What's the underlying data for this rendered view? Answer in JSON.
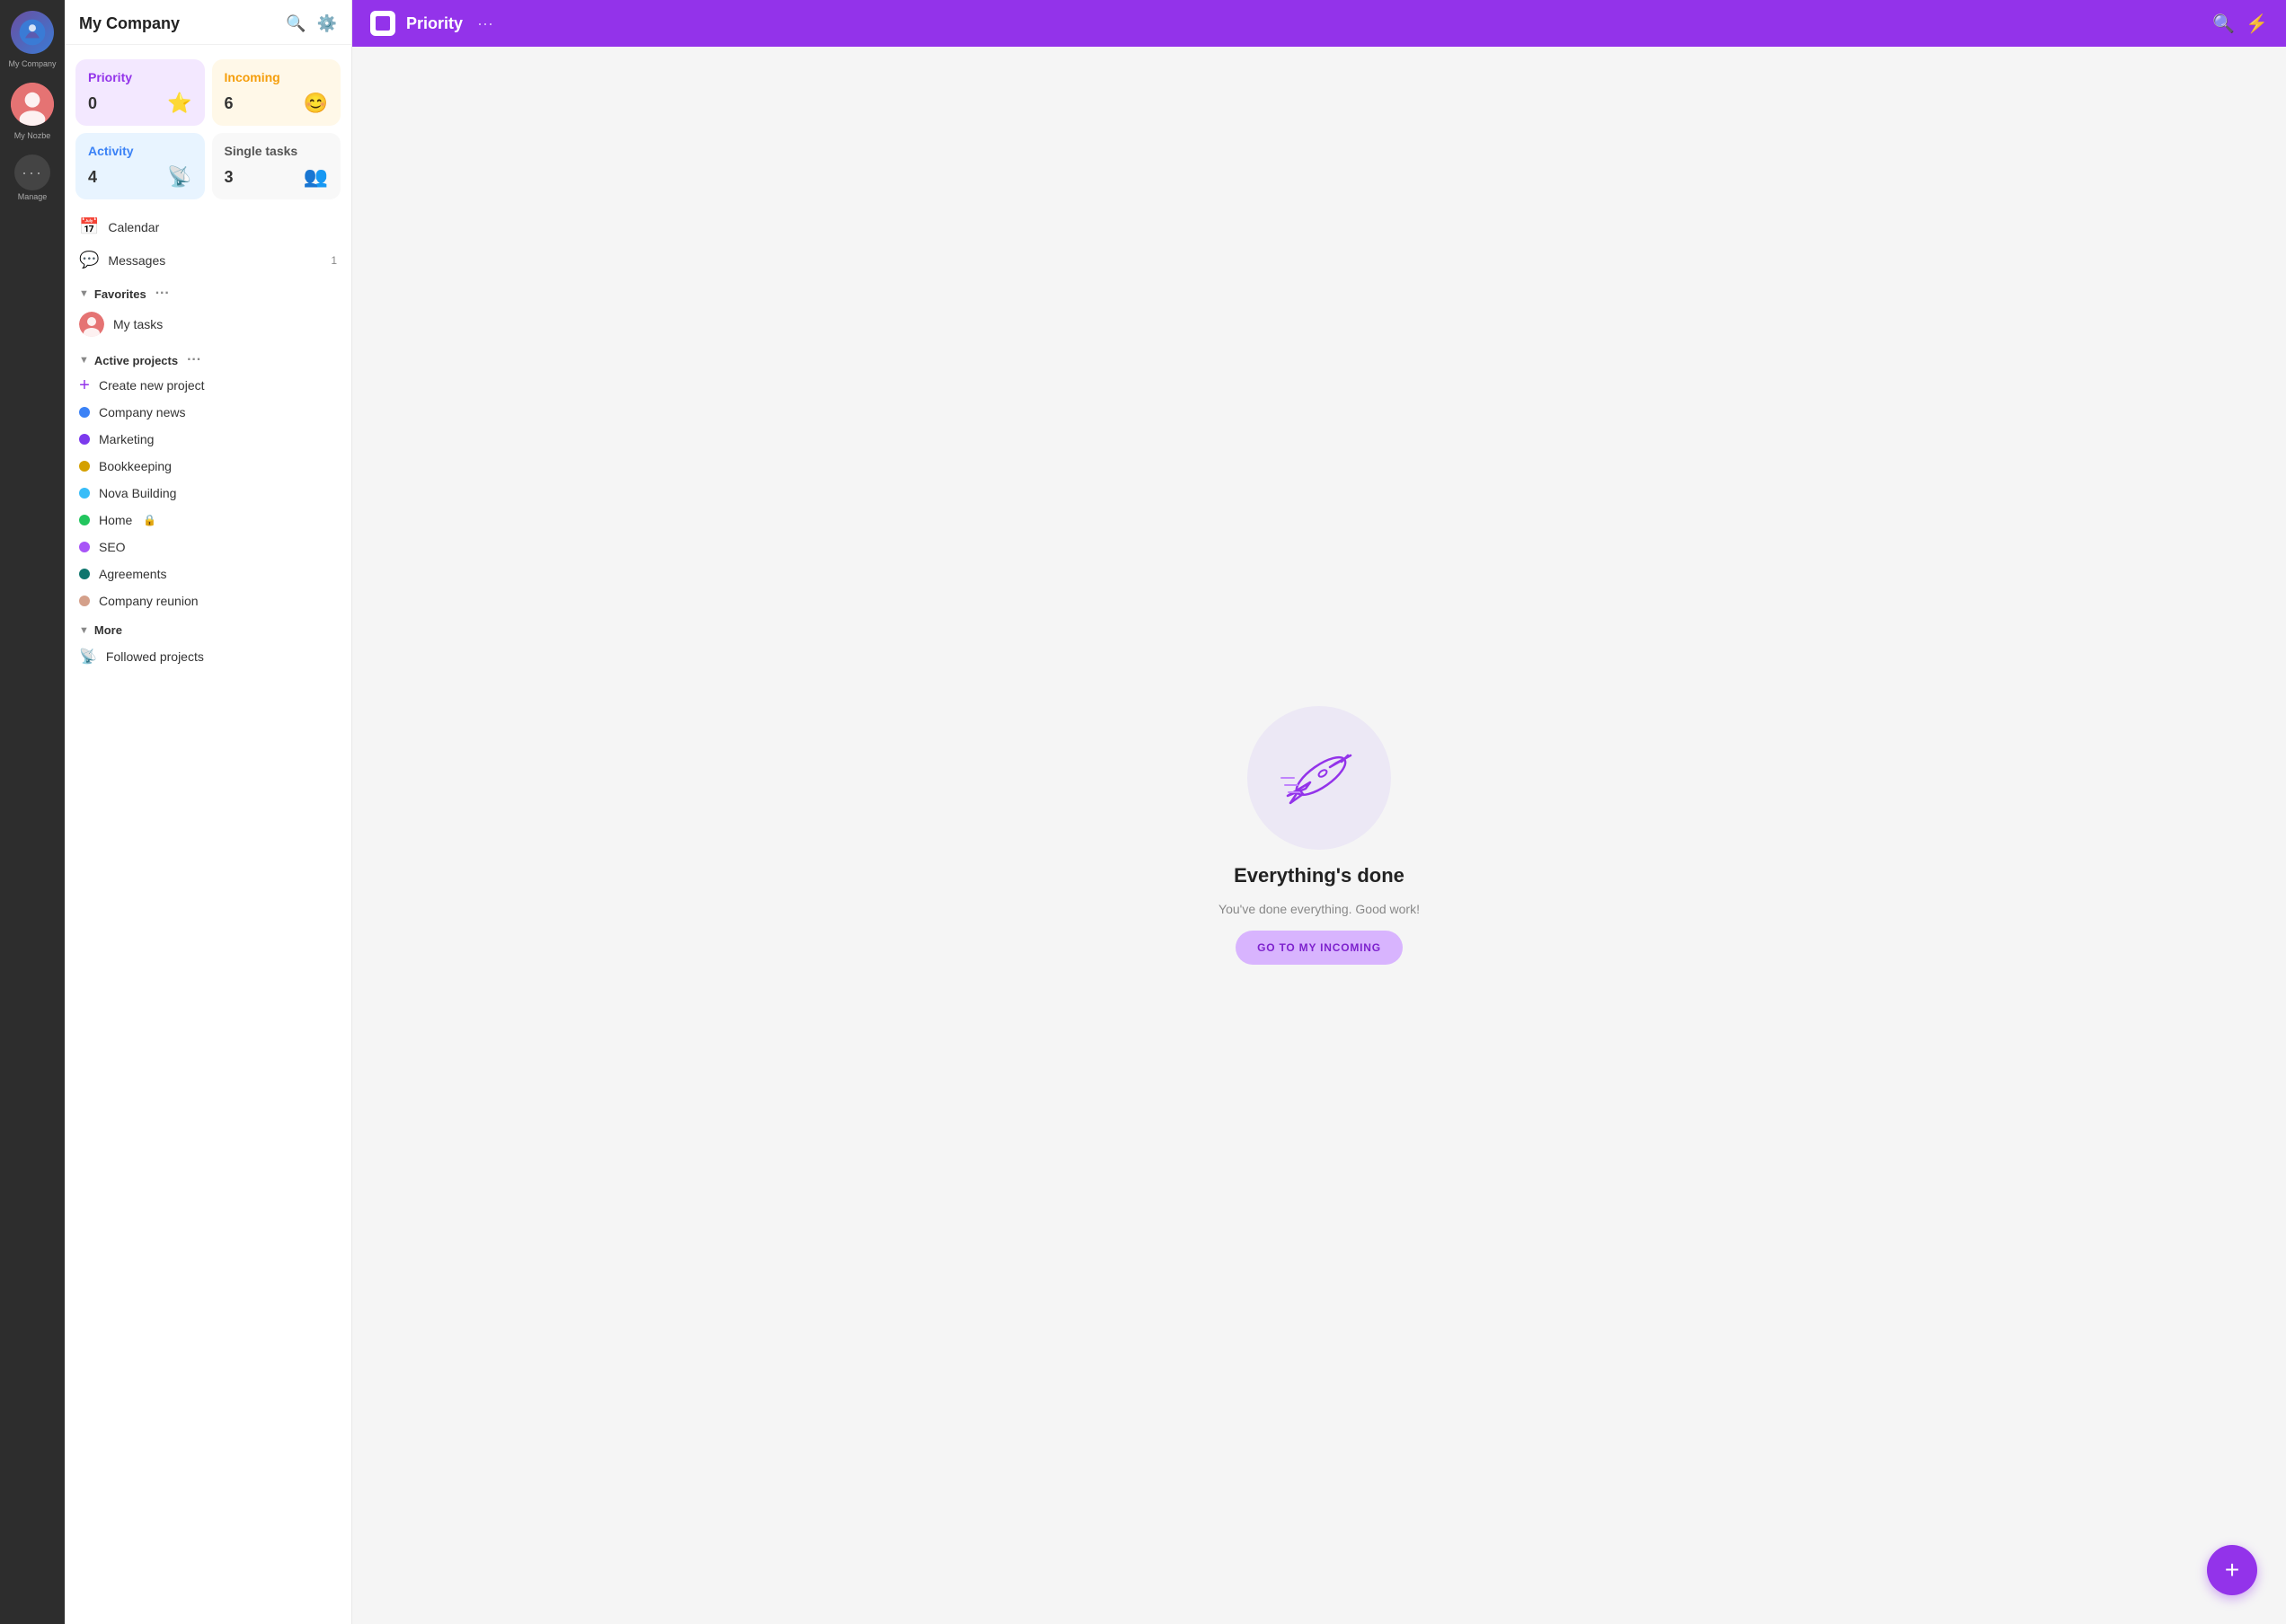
{
  "leftRail": {
    "companyLabel": "My Company",
    "nozbeLabel": "My Nozbe",
    "manageLabel": "Manage"
  },
  "sidebar": {
    "title": "My Company",
    "cards": [
      {
        "id": "priority",
        "label": "Priority",
        "count": "0",
        "icon": "⭐",
        "theme": "priority"
      },
      {
        "id": "incoming",
        "label": "Incoming",
        "count": "6",
        "icon": "😊",
        "theme": "incoming"
      },
      {
        "id": "activity",
        "label": "Activity",
        "count": "4",
        "icon": "📡",
        "theme": "activity"
      },
      {
        "id": "single",
        "label": "Single tasks",
        "count": "3",
        "icon": "👥",
        "theme": "single"
      }
    ],
    "nav": [
      {
        "id": "calendar",
        "label": "Calendar",
        "icon": "📅",
        "badge": ""
      },
      {
        "id": "messages",
        "label": "Messages",
        "icon": "💬",
        "badge": "1"
      }
    ],
    "favorites": {
      "label": "Favorites",
      "items": [
        {
          "id": "my-tasks",
          "label": "My tasks",
          "dotColor": "#e57373"
        }
      ]
    },
    "activeProjects": {
      "label": "Active projects",
      "items": [
        {
          "id": "create-new",
          "label": "Create new project",
          "dotColor": "#9333ea",
          "isPlus": true
        },
        {
          "id": "company-news",
          "label": "Company news",
          "dotColor": "#3b82f6"
        },
        {
          "id": "marketing",
          "label": "Marketing",
          "dotColor": "#7c3aed"
        },
        {
          "id": "bookkeeping",
          "label": "Bookkeeping",
          "dotColor": "#d4a000"
        },
        {
          "id": "nova-building",
          "label": "Nova Building",
          "dotColor": "#38bdf8"
        },
        {
          "id": "home",
          "label": "Home",
          "dotColor": "#22c55e",
          "locked": true
        },
        {
          "id": "seo",
          "label": "SEO",
          "dotColor": "#a855f7"
        },
        {
          "id": "agreements",
          "label": "Agreements",
          "dotColor": "#0f766e"
        },
        {
          "id": "company-reunion",
          "label": "Company reunion",
          "dotColor": "#d4a08a"
        }
      ]
    },
    "more": {
      "label": "More",
      "items": [
        {
          "id": "followed-projects",
          "label": "Followed projects",
          "icon": "📡"
        }
      ]
    }
  },
  "topbar": {
    "title": "Priority",
    "dotsLabel": "···"
  },
  "emptyState": {
    "title": "Everything's done",
    "subtitle": "You've done everything. Good work!",
    "buttonLabel": "GO TO MY INCOMING"
  },
  "fab": {
    "label": "+"
  }
}
